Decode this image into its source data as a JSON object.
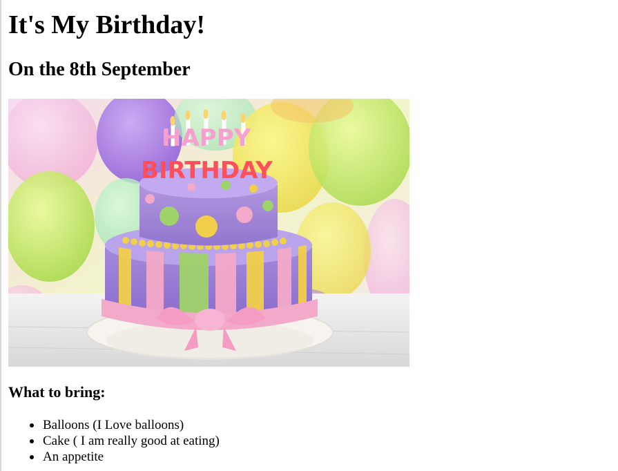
{
  "page": {
    "title": "It's My Birthday!",
    "subtitle": "On the 8th September"
  },
  "image": {
    "cake_topper": {
      "line1": "HAPPY",
      "line2": "BIRTHDAY"
    }
  },
  "bring": {
    "heading": "What to bring:",
    "items": [
      "Balloons (I Love balloons)",
      "Cake ( I am really good at eating)",
      "An appetite"
    ]
  },
  "colors": {
    "text": "#000000",
    "background": "#ffffff",
    "cake_purple": "#a58bd6",
    "ribbon_pink": "#f3a9c9",
    "accent_yellow": "#f2cf4a",
    "accent_green": "#9fd36a"
  }
}
